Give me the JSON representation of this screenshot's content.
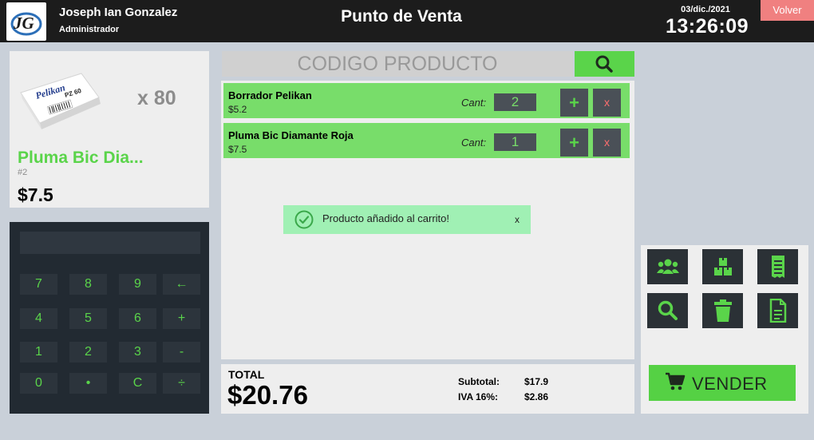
{
  "header": {
    "user_name": "Joseph Ian Gonzalez",
    "user_role": "Administrador",
    "title": "Punto de Venta",
    "date": "03/dic./2021",
    "time": "13:26:09",
    "back_label": "Volver"
  },
  "preview": {
    "quantity": "x 80",
    "name": "Pluma Bic Dia...",
    "id": "#2",
    "price": "$7.5",
    "image_text": [
      "Pelikan",
      "PZ 60"
    ]
  },
  "keypad": {
    "display": "",
    "keys": [
      "7",
      "8",
      "9",
      "←",
      "4",
      "5",
      "6",
      "+",
      "1",
      "2",
      "3",
      "-",
      "0",
      "•",
      "C",
      "÷"
    ]
  },
  "search": {
    "placeholder": "CODIGO PRODUCTO"
  },
  "cart": {
    "qty_label": "Cant:",
    "items": [
      {
        "name": "Borrador Pelikan",
        "price": "$5.2",
        "qty": "2"
      },
      {
        "name": "Pluma Bic Diamante Roja",
        "price": "$7.5",
        "qty": "1"
      }
    ],
    "plus_label": "+",
    "remove_label": "x"
  },
  "toast": {
    "message": "Producto añadido al carrito!",
    "close": "x"
  },
  "totals": {
    "total_label": "TOTAL",
    "total": "$20.76",
    "subtotal_label": "Subtotal:",
    "subtotal": "$17.9",
    "iva_label": "IVA 16%:",
    "iva": "$2.86"
  },
  "actions": {
    "sell_label": "VENDER",
    "icons": [
      "users-icon",
      "boxes-icon",
      "receipt-icon",
      "search-icon",
      "trash-icon",
      "document-icon"
    ]
  },
  "colors": {
    "accent_green": "#5ad44a",
    "cart_row_green": "#78dd6a",
    "header_bg": "#1c1c1c",
    "back_button": "#f08080",
    "toast_bg": "#a0f0b4",
    "dark_panel": "#222a32"
  }
}
